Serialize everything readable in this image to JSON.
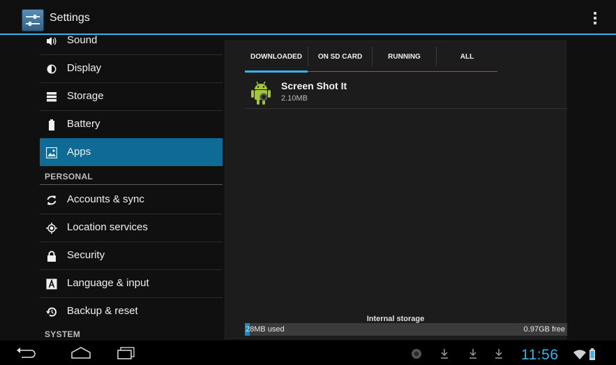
{
  "app": {
    "title": "Settings"
  },
  "colors": {
    "accent": "#33b5e5",
    "selected": "#0d6b96"
  },
  "sidebar": {
    "items": [
      {
        "label": "Sound",
        "icon": "speaker-icon"
      },
      {
        "label": "Display",
        "icon": "brightness-icon"
      },
      {
        "label": "Storage",
        "icon": "storage-icon"
      },
      {
        "label": "Battery",
        "icon": "battery-icon"
      },
      {
        "label": "Apps",
        "icon": "apps-icon",
        "selected": true
      }
    ],
    "personal_header": "PERSONAL",
    "personal_items": [
      {
        "label": "Accounts & sync",
        "icon": "sync-icon"
      },
      {
        "label": "Location services",
        "icon": "location-icon"
      },
      {
        "label": "Security",
        "icon": "lock-icon"
      },
      {
        "label": "Language & input",
        "icon": "keyboard-icon"
      },
      {
        "label": "Backup & reset",
        "icon": "backup-icon"
      }
    ],
    "system_header": "SYSTEM"
  },
  "tabs": [
    {
      "label": "DOWNLOADED",
      "selected": true
    },
    {
      "label": "ON SD CARD"
    },
    {
      "label": "RUNNING"
    },
    {
      "label": "ALL"
    }
  ],
  "apps_list": [
    {
      "name": "Screen Shot It",
      "size": "2.10MB",
      "icon": "android-icon"
    }
  ],
  "storage": {
    "label": "Internal storage",
    "used": "28MB used",
    "free": "0.97GB free",
    "used_fraction": 0.015
  },
  "system_bar": {
    "clock": "11:56"
  }
}
